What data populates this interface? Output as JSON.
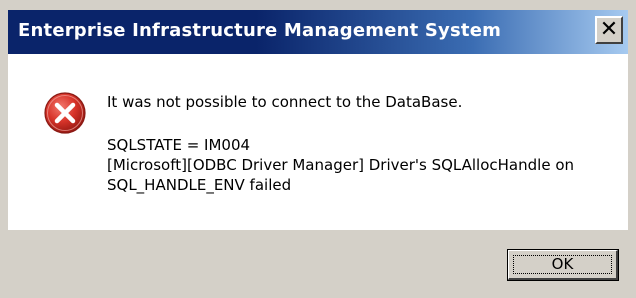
{
  "dialog": {
    "title": "Enterprise Infrastructure Management System",
    "close_glyph": "✕",
    "icon": "error-icon"
  },
  "message": {
    "line1": "It was not possible to connect to the DataBase.",
    "line2": "SQLSTATE = IM004",
    "line3": "[Microsoft][ODBC Driver Manager] Driver's SQLAllocHandle on",
    "line4": "SQL_HANDLE_ENV failed"
  },
  "buttons": {
    "ok_label": "OK"
  },
  "colors": {
    "titlebar_start": "#0a246a",
    "titlebar_end": "#a6caf0",
    "error_red": "#d8342a",
    "dialog_face": "#d4d0c8"
  }
}
